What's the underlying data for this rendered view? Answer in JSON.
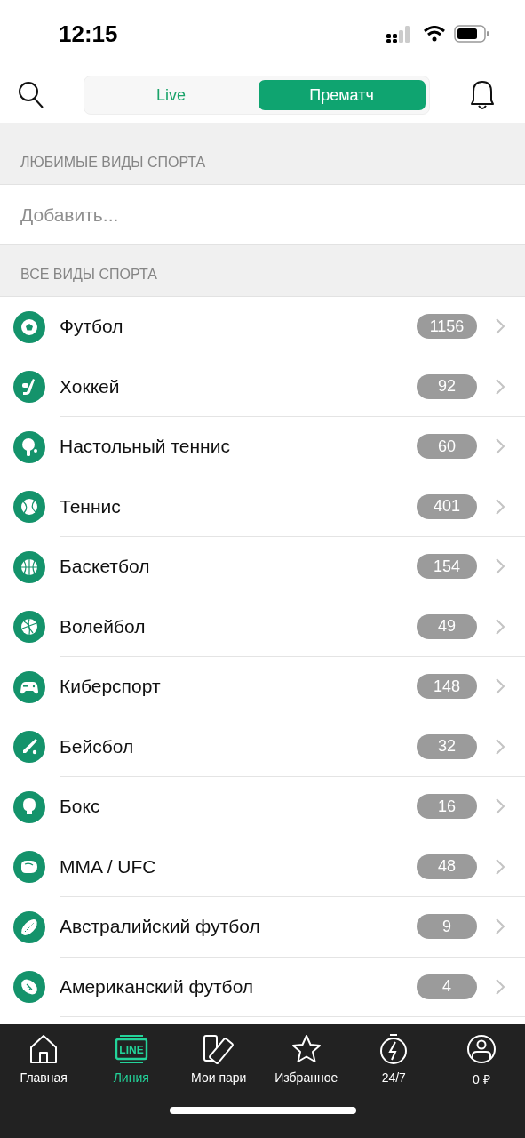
{
  "status_bar": {
    "time": "12:15"
  },
  "tabs": [
    {
      "label": "Live",
      "selected": false
    },
    {
      "label": "Прематч",
      "selected": true
    }
  ],
  "favorites": {
    "title": "ЛЮБИМЫЕ ВИДЫ СПОРТА",
    "placeholder": "Добавить..."
  },
  "all_sports": {
    "title": "ВСЕ ВИДЫ СПОРТА",
    "items": [
      {
        "name": "Футбол",
        "count": "1156"
      },
      {
        "name": "Хоккей",
        "count": "92"
      },
      {
        "name": "Настольный теннис",
        "count": "60"
      },
      {
        "name": "Теннис",
        "count": "401"
      },
      {
        "name": "Баскетбол",
        "count": "154"
      },
      {
        "name": "Волейбол",
        "count": "49"
      },
      {
        "name": "Киберспорт",
        "count": "148"
      },
      {
        "name": "Бейсбол",
        "count": "32"
      },
      {
        "name": "Бокс",
        "count": "16"
      },
      {
        "name": "MMA / UFC",
        "count": "48"
      },
      {
        "name": "Австралийский футбол",
        "count": "9"
      },
      {
        "name": "Американский футбол",
        "count": "4"
      }
    ]
  },
  "bottom_nav": [
    {
      "label": "Главная",
      "selected": false
    },
    {
      "label": "Линия",
      "selected": true,
      "icon_text": "LINE"
    },
    {
      "label": "Мои пари",
      "selected": false
    },
    {
      "label": "Избранное",
      "selected": false
    },
    {
      "label": "24/7",
      "selected": false
    },
    {
      "label": "0 ₽",
      "selected": false
    }
  ]
}
